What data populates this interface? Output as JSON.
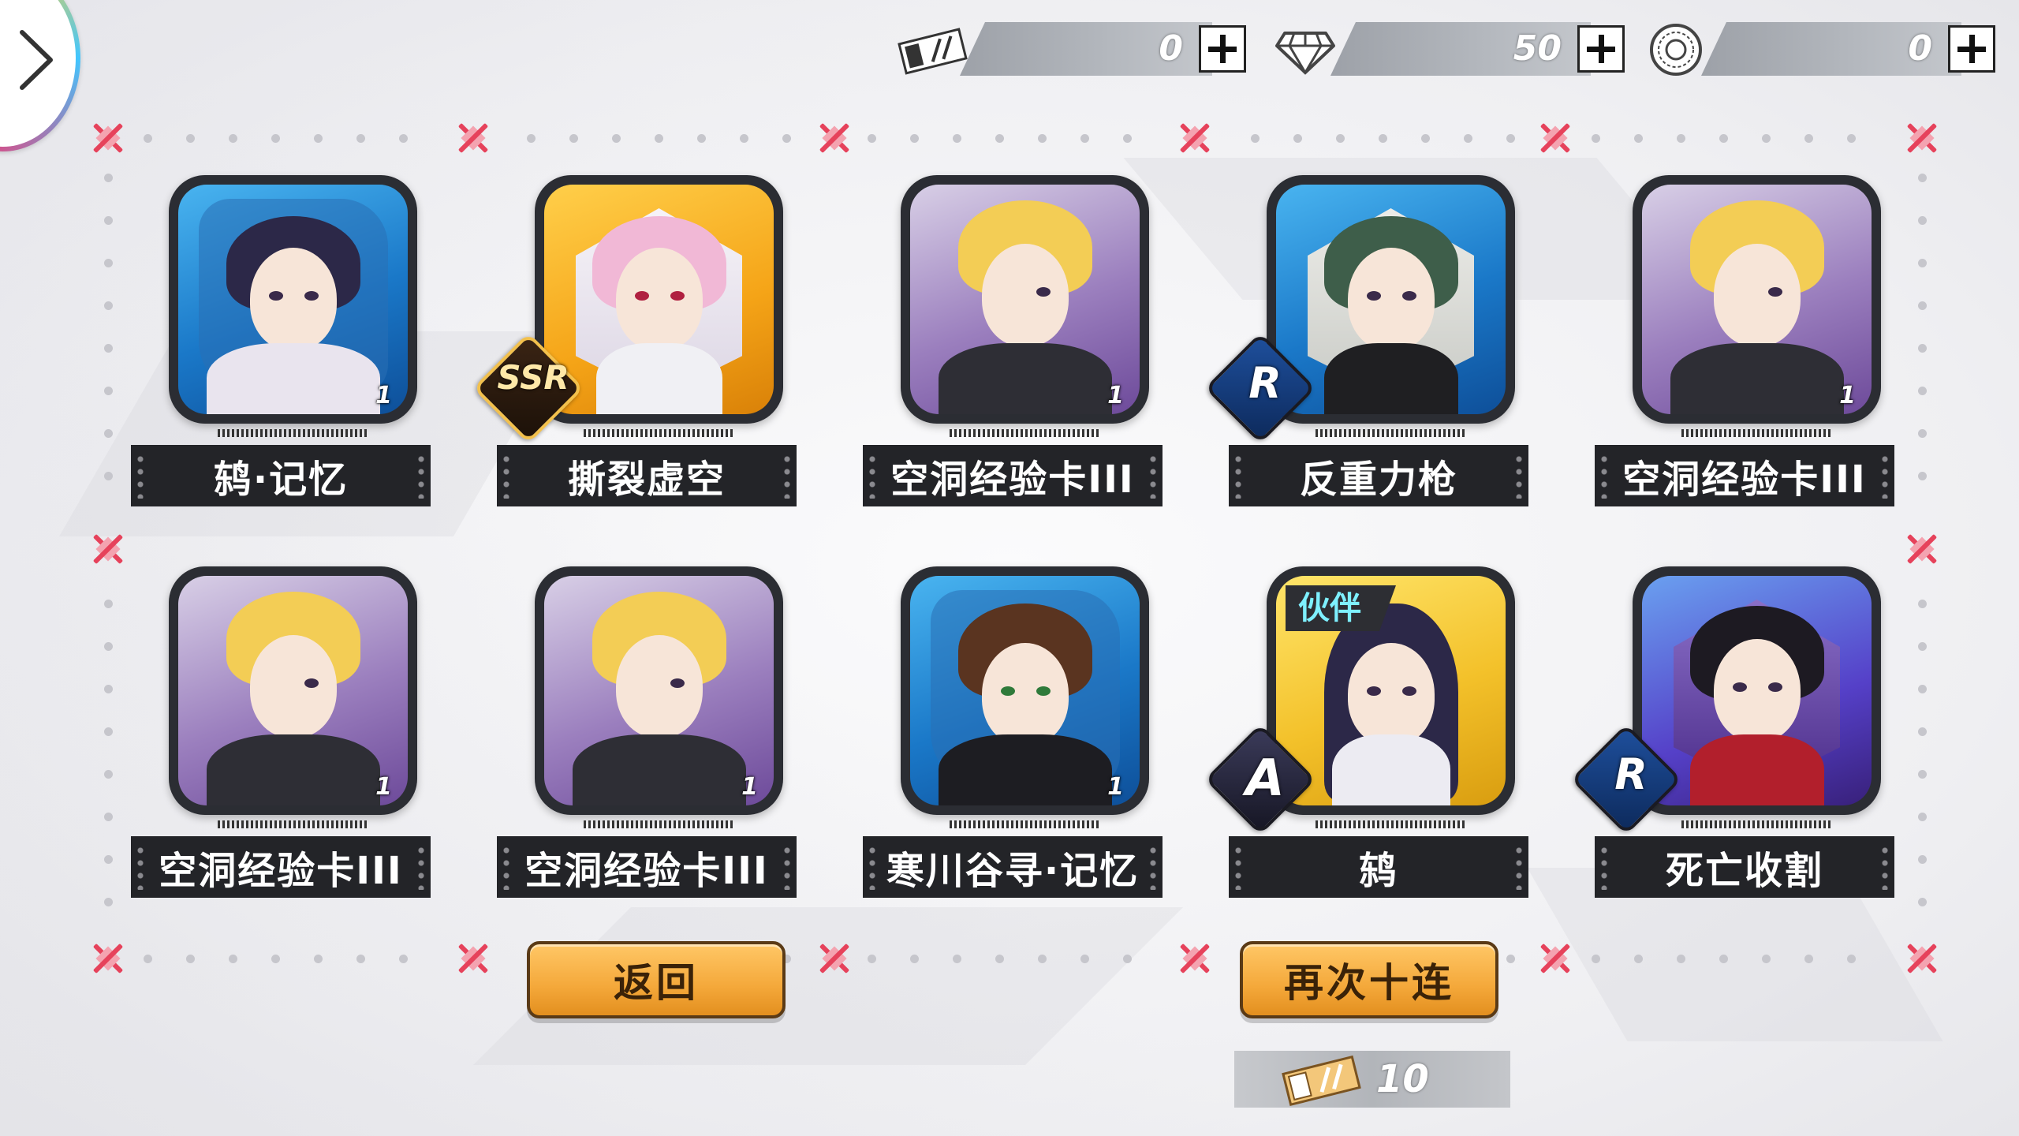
{
  "currencies": [
    {
      "icon": "gacha-ticket-icon",
      "value": "0"
    },
    {
      "icon": "diamond-icon",
      "value": "50"
    },
    {
      "icon": "crystal-coin-icon",
      "value": "0"
    }
  ],
  "rewards": [
    {
      "name": "鸫·记忆",
      "count": "1",
      "rarity": "",
      "theme": "blue",
      "tag": ""
    },
    {
      "name": "撕裂虚空",
      "count": "",
      "rarity": "SSR",
      "theme": "gold",
      "tag": ""
    },
    {
      "name": "空洞经验卡III",
      "count": "1",
      "rarity": "",
      "theme": "purple",
      "tag": ""
    },
    {
      "name": "反重力枪",
      "count": "",
      "rarity": "R",
      "theme": "blue",
      "tag": ""
    },
    {
      "name": "空洞经验卡III",
      "count": "1",
      "rarity": "",
      "theme": "purple",
      "tag": ""
    },
    {
      "name": "空洞经验卡III",
      "count": "1",
      "rarity": "",
      "theme": "purple",
      "tag": ""
    },
    {
      "name": "空洞经验卡III",
      "count": "1",
      "rarity": "",
      "theme": "purple",
      "tag": ""
    },
    {
      "name": "寒川谷寻·记忆",
      "count": "1",
      "rarity": "",
      "theme": "blue",
      "tag": ""
    },
    {
      "name": "鸫",
      "count": "",
      "rarity": "A",
      "theme": "yellow",
      "tag": "伙伴"
    },
    {
      "name": "死亡收割",
      "count": "",
      "rarity": "R",
      "theme": "violet",
      "tag": ""
    }
  ],
  "buttons": {
    "back": "返回",
    "pull_again": "再次十连"
  },
  "cost": {
    "icon": "gacha-ticket-icon",
    "value": "10"
  },
  "colors": {
    "accent_orange": "#f4a83a",
    "frame_mark_red": "#e6425b",
    "label_bg": "#232428"
  }
}
